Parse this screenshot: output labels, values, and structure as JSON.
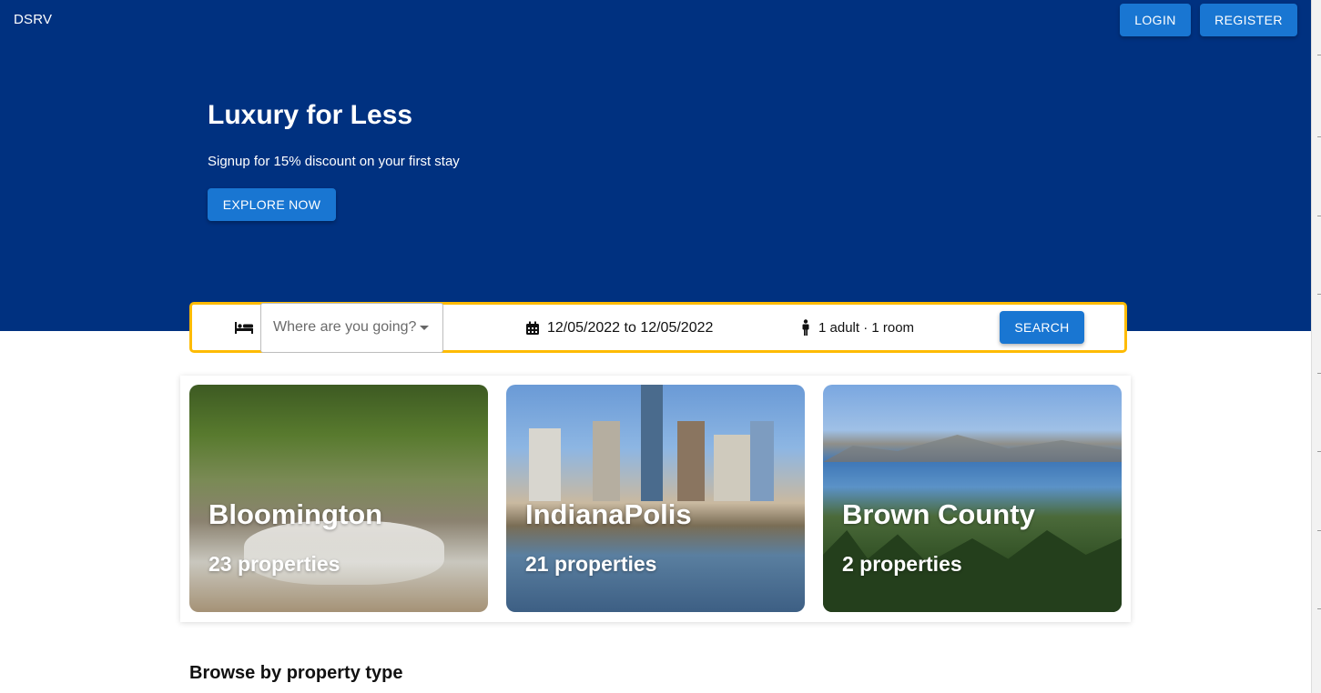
{
  "header": {
    "brand": "DSRV",
    "login_label": "LOGIN",
    "register_label": "REGISTER",
    "background_color": "#003180",
    "button_color": "#1976d2"
  },
  "hero": {
    "title": "Luxury for Less",
    "subtitle": "Signup for 15% discount on your first stay",
    "explore_label": "EXPLORE NOW"
  },
  "search": {
    "bed_icon": "bed-icon",
    "destination_placeholder": "Where are you going?",
    "calendar_icon": "calendar-icon",
    "date_range": "12/05/2022 to 12/05/2022",
    "person_icon": "person-icon",
    "guests": "1 adult · 1 room",
    "search_label": "SEARCH",
    "border_color": "#febb02"
  },
  "featured": [
    {
      "city": "Bloomington",
      "properties": "23 properties"
    },
    {
      "city": "IndianaPolis",
      "properties": "21 properties"
    },
    {
      "city": "Brown County",
      "properties": "2 properties"
    }
  ],
  "browse": {
    "title": "Browse by property type"
  }
}
